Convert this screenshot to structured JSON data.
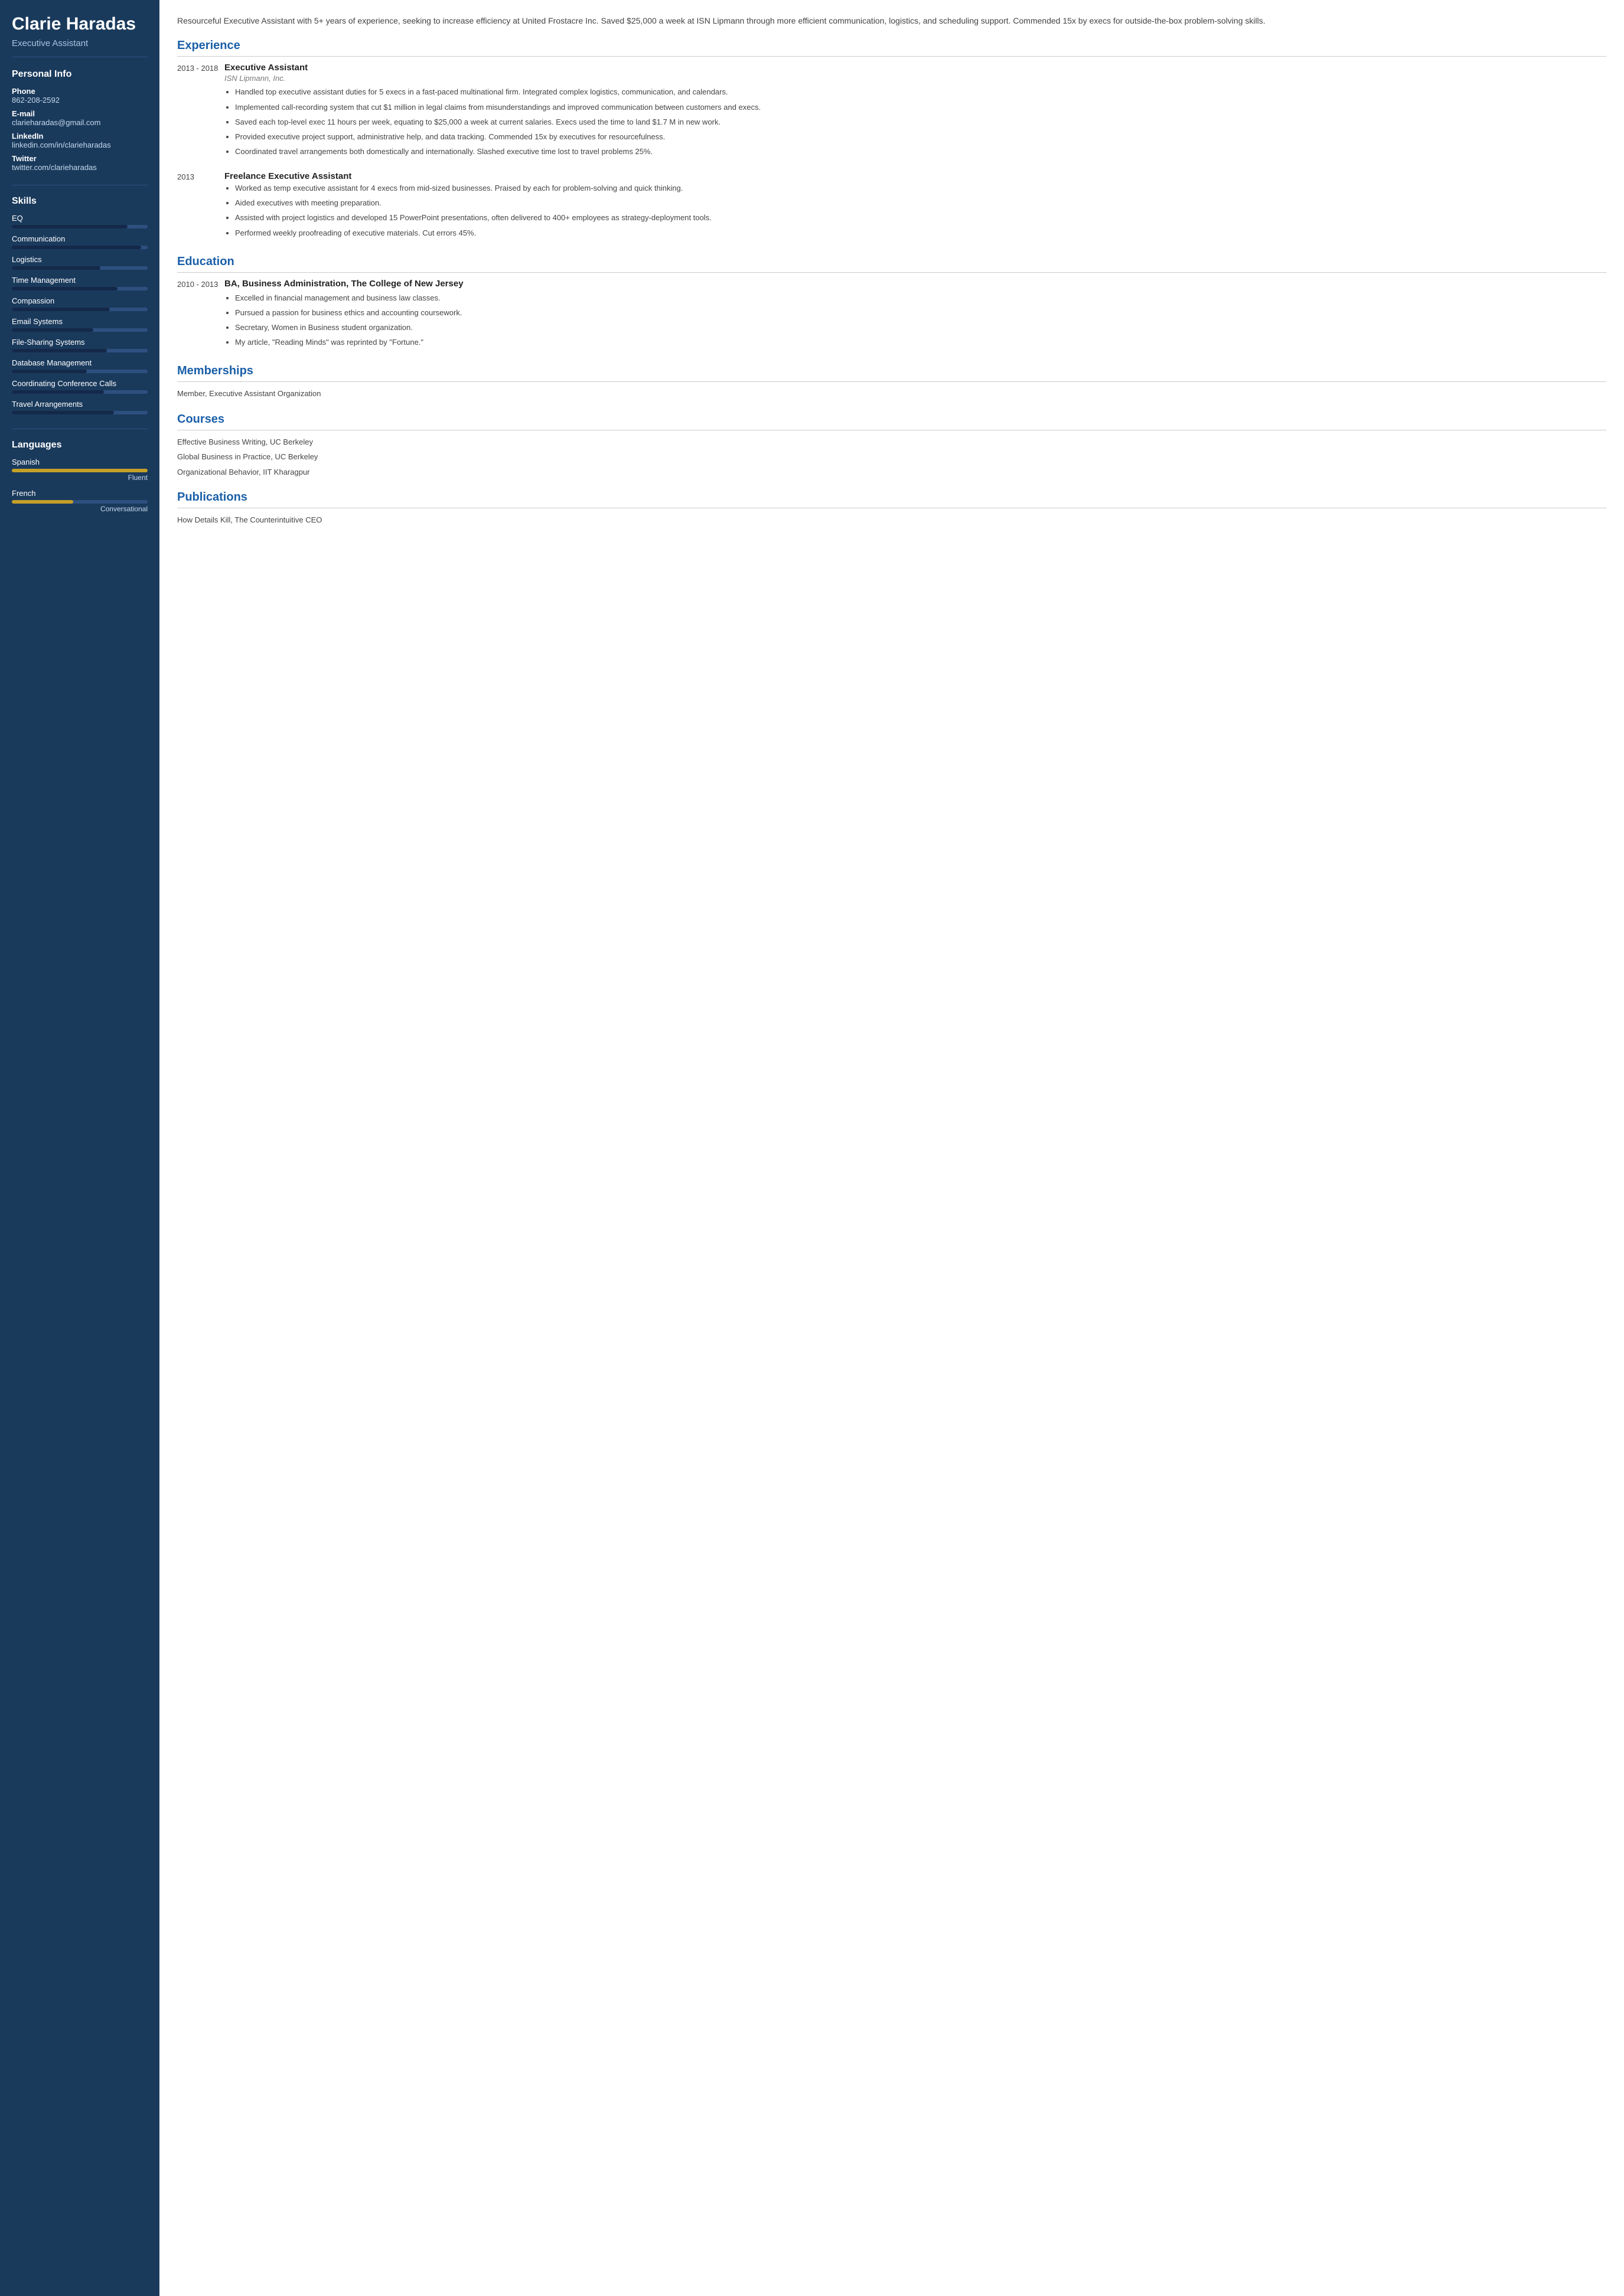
{
  "sidebar": {
    "name": "Clarie Haradas",
    "title": "Executive Assistant",
    "personal_info": {
      "section_title": "Personal Info",
      "items": [
        {
          "label": "Phone",
          "value": "862-208-2592"
        },
        {
          "label": "E-mail",
          "value": "clarieharadas@gmail.com"
        },
        {
          "label": "LinkedIn",
          "value": "linkedin.com/in/clarieharadas"
        },
        {
          "label": "Twitter",
          "value": "twitter.com/clarieharadas"
        }
      ]
    },
    "skills": {
      "section_title": "Skills",
      "items": [
        {
          "name": "EQ",
          "fill_pct": 85
        },
        {
          "name": "Communication",
          "fill_pct": 95
        },
        {
          "name": "Logistics",
          "fill_pct": 65
        },
        {
          "name": "Time Management",
          "fill_pct": 78
        },
        {
          "name": "Compassion",
          "fill_pct": 72
        },
        {
          "name": "Email Systems",
          "fill_pct": 60
        },
        {
          "name": "File-Sharing Systems",
          "fill_pct": 70
        },
        {
          "name": "Database Management",
          "fill_pct": 55
        },
        {
          "name": "Coordinating Conference Calls",
          "fill_pct": 68
        },
        {
          "name": "Travel Arrangements",
          "fill_pct": 75
        }
      ]
    },
    "languages": {
      "section_title": "Languages",
      "items": [
        {
          "name": "Spanish",
          "fill_pct": 100,
          "level": "Fluent"
        },
        {
          "name": "French",
          "fill_pct": 45,
          "level": "Conversational"
        }
      ]
    }
  },
  "main": {
    "summary": "Resourceful Executive Assistant with 5+ years of experience, seeking to increase efficiency at United Frostacre Inc. Saved $25,000 a week at ISN Lipmann through more efficient communication, logistics, and scheduling support. Commended 15x by execs for outside-the-box problem-solving skills.",
    "experience": {
      "section_title": "Experience",
      "entries": [
        {
          "date": "2013 - 2018",
          "title": "Executive Assistant",
          "company": "ISN Lipmann, Inc.",
          "bullets": [
            "Handled top executive assistant duties for 5 execs in a fast-paced multinational firm. Integrated complex logistics, communication, and calendars.",
            "Implemented call-recording system that cut $1 million in legal claims from misunderstandings and improved communication between customers and execs.",
            "Saved each top-level exec 11 hours per week, equating to $25,000 a week at current salaries. Execs used the time to land $1.7 M in new work.",
            "Provided executive project support, administrative help, and data tracking. Commended 15x by executives for resourcefulness.",
            "Coordinated travel arrangements both domestically and internationally. Slashed executive time lost to travel problems 25%."
          ]
        },
        {
          "date": "2013",
          "title": "Freelance Executive Assistant",
          "company": "",
          "bullets": [
            "Worked as temp executive assistant for 4 execs from mid-sized businesses. Praised by each for problem-solving and quick thinking.",
            "Aided executives with meeting preparation.",
            "Assisted with project logistics and developed 15 PowerPoint presentations, often delivered to 400+ employees as strategy-deployment tools.",
            "Performed weekly proofreading of executive materials. Cut errors 45%."
          ]
        }
      ]
    },
    "education": {
      "section_title": "Education",
      "entries": [
        {
          "date": "2010 - 2013",
          "degree": "BA, Business Administration, The College of New Jersey",
          "bullets": [
            "Excelled in financial management and business law classes.",
            "Pursued a passion for business ethics and accounting coursework.",
            "Secretary, Women in Business student organization.",
            "My article, \"Reading Minds\" was reprinted by \"Fortune.\""
          ]
        }
      ]
    },
    "memberships": {
      "section_title": "Memberships",
      "items": [
        "Member, Executive Assistant Organization"
      ]
    },
    "courses": {
      "section_title": "Courses",
      "items": [
        "Effective Business Writing, UC Berkeley",
        "Global Business in Practice, UC Berkeley",
        "Organizational Behavior, IIT Kharagpur"
      ]
    },
    "publications": {
      "section_title": "Publications",
      "items": [
        "How Details Kill, The Counterintuitive CEO"
      ]
    }
  }
}
